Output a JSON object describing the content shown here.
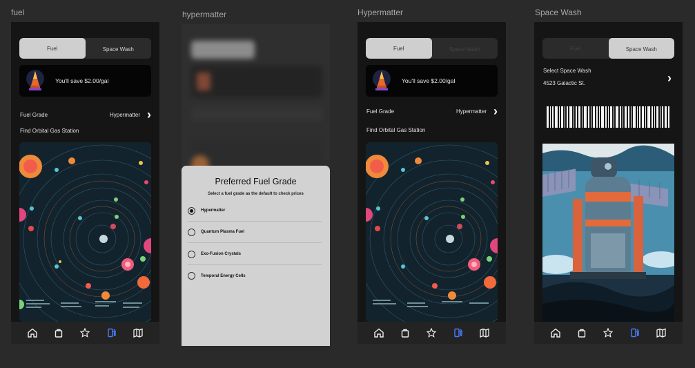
{
  "frames": {
    "fuel_title": "fuel",
    "hyper_sheet_title": "hypermatter",
    "hyper_title": "Hypermatter",
    "wash_title": "Space Wash"
  },
  "segment": {
    "fuel": "Fuel",
    "wash": "Space Wash"
  },
  "promo": {
    "text": "You'll save $2.00/gal"
  },
  "fuel_grade": {
    "label": "Fuel Grade",
    "value": "Hypermatter"
  },
  "find_station": "Find Orbital Gas Station",
  "sheet": {
    "title": "Preferred Fuel Grade",
    "subtitle": "Select a fuel grade as the default to check prices",
    "options": [
      {
        "label": "Hypermatter",
        "selected": true
      },
      {
        "label": "Quantum Plasma Fuel",
        "selected": false
      },
      {
        "label": "Exo-Fusion Crystals",
        "selected": false
      },
      {
        "label": "Temporal Energy Cells",
        "selected": false
      }
    ]
  },
  "wash": {
    "select_label": "Select Space Wash",
    "address": "4523 Galactic St."
  },
  "tabbar": {
    "icons": [
      "home-icon",
      "bag-icon",
      "star-icon",
      "fuel-pump-icon",
      "map-icon"
    ],
    "active": "fuel-pump-icon",
    "accent": "#4a7dff"
  },
  "colors": {
    "page_bg": "#2a2a2a",
    "phone_bg": "#151515",
    "accent": "#4a7dff"
  }
}
